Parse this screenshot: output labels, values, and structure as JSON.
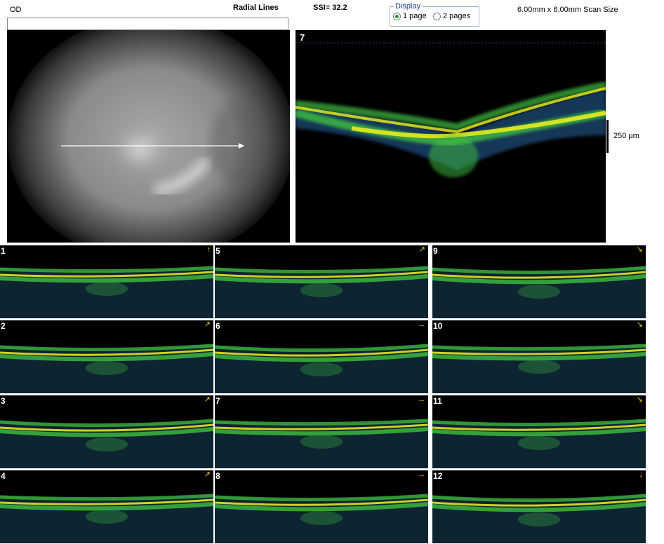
{
  "header": {
    "eye": "OD",
    "title": "Radial Lines",
    "ssi": "SSI= 32.2",
    "scan_size": "6.00mm x 6.00mm Scan Size"
  },
  "display": {
    "legend": "Display",
    "options": [
      "1 page",
      "2 pages"
    ],
    "selected": "1 page"
  },
  "main_scan": {
    "number": "7",
    "scale_label": "250 µm"
  },
  "thumbnails": [
    {
      "number": "1",
      "arrow": "↑"
    },
    {
      "number": "2",
      "arrow": "↗"
    },
    {
      "number": "3",
      "arrow": "↗"
    },
    {
      "number": "4",
      "arrow": "↗"
    },
    {
      "number": "5",
      "arrow": "↗"
    },
    {
      "number": "6",
      "arrow": "→"
    },
    {
      "number": "7",
      "arrow": "→"
    },
    {
      "number": "8",
      "arrow": "→"
    },
    {
      "number": "9",
      "arrow": "↘"
    },
    {
      "number": "10",
      "arrow": "↘"
    },
    {
      "number": "11",
      "arrow": "↘"
    },
    {
      "number": "12",
      "arrow": "↓"
    }
  ],
  "colors": {
    "arrow": "#ffd200",
    "retina_bright": "#f0f020",
    "retina_mid": "#3fbf3f",
    "retina_noise": "#2a6fb0"
  }
}
